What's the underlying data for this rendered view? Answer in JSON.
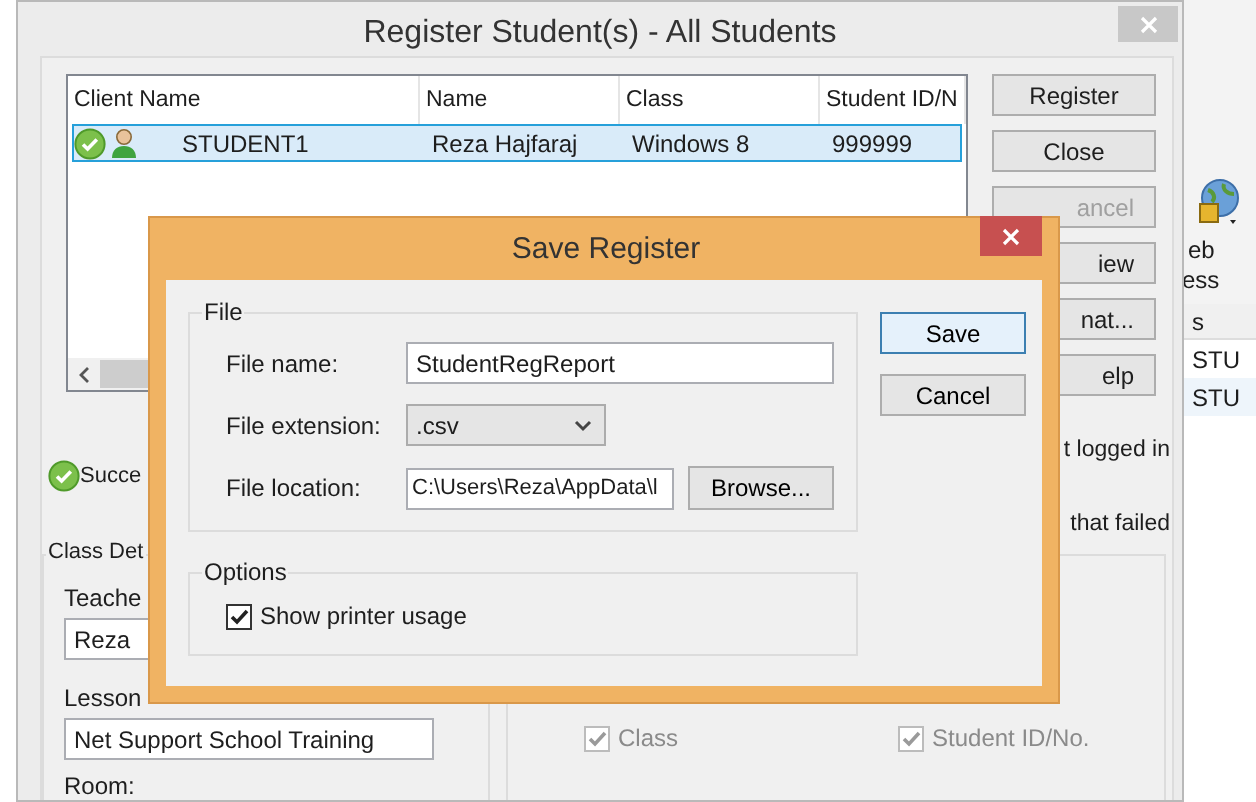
{
  "background_app": {
    "toolbar_labels": [
      "eb",
      "ess"
    ],
    "list_header": "s",
    "list_rows": [
      "STU",
      "STU"
    ]
  },
  "window": {
    "title": "Register Student(s) - All Students"
  },
  "students_table": {
    "columns": [
      "Client Name",
      "Name",
      "Class",
      "Student ID/N"
    ],
    "rows": [
      {
        "selected": true,
        "cells": [
          "STUDENT1",
          "Reza Hajfaraj",
          "Windows 8",
          "999999"
        ]
      }
    ]
  },
  "side_buttons": [
    {
      "label": "Register",
      "disabled": false
    },
    {
      "label": "Close",
      "disabled": false
    },
    {
      "label": "ancel",
      "disabled": true
    },
    {
      "label": "iew",
      "disabled": false
    },
    {
      "label": "nat...",
      "disabled": false
    },
    {
      "label": "elp",
      "disabled": false
    }
  ],
  "side_notes": [
    "t logged in",
    "that failed"
  ],
  "status": "Succe",
  "class_details": {
    "title": "Class Det",
    "teacher_label": "Teache",
    "teacher_value": "Reza",
    "lesson_label": "Lesson",
    "lesson_value": "Net Support School Training",
    "room_label": "Room:"
  },
  "column_options": [
    {
      "label": "Class",
      "checked": true,
      "disabled": true
    },
    {
      "label": "Student ID/No.",
      "checked": true,
      "disabled": true
    }
  ],
  "dialog": {
    "title": "Save Register",
    "file_group": "File",
    "file_name_label": "File name:",
    "file_name": "StudentRegReport",
    "extension_label": "File extension:",
    "extension": ".csv",
    "location_label": "File location:",
    "location": "C:\\Users\\Reza\\AppData\\l",
    "browse": "Browse...",
    "options_group": "Options",
    "options": [
      {
        "label": "Show printer usage",
        "checked": true
      }
    ],
    "buttons": [
      {
        "label": "Save",
        "focused": true
      },
      {
        "label": "Cancel",
        "focused": false
      }
    ]
  }
}
